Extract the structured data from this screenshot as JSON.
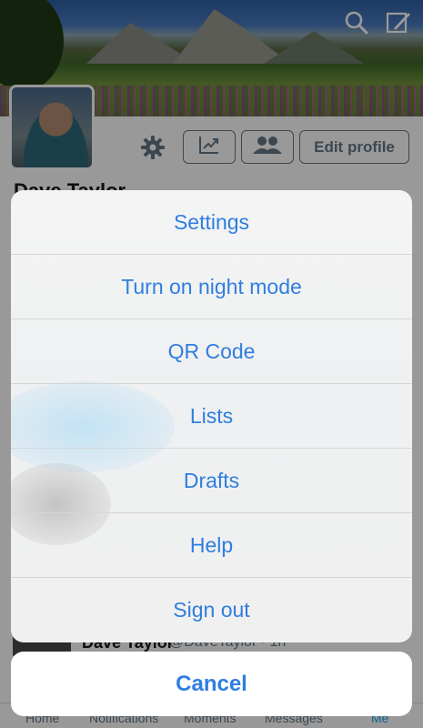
{
  "profile": {
    "name": "Dave Taylor",
    "edit_profile_label": "Edit profile"
  },
  "tweet": {
    "name": "Dave Taylor",
    "handle": "@DaveTaylor · 1h"
  },
  "tabs": [
    "Home",
    "Notifications",
    "Moments",
    "Messages",
    "Me"
  ],
  "menu": {
    "items": [
      "Settings",
      "Turn on night mode",
      "QR Code",
      "Lists",
      "Drafts",
      "Help",
      "Sign out"
    ],
    "cancel_label": "Cancel"
  },
  "colors": {
    "accent": "#2f7ee0",
    "twitter_blue": "#1da1f2"
  },
  "icons": {
    "top_left_action": "search-icon",
    "top_right_action": "compose-icon",
    "settings": "gear-icon",
    "analytics": "analytics-icon",
    "people": "people-icon"
  }
}
